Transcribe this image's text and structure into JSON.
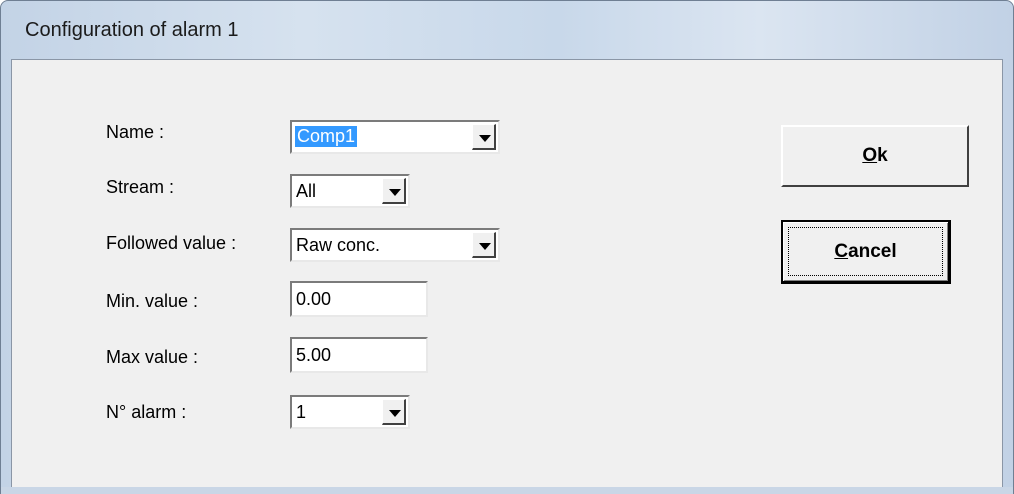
{
  "window": {
    "title": "Configuration of alarm 1"
  },
  "form": {
    "name": {
      "label": "Name :",
      "value": "Comp1"
    },
    "stream": {
      "label": "Stream :",
      "value": "All"
    },
    "followed": {
      "label": "Followed value :",
      "value": "Raw conc."
    },
    "min": {
      "label": "Min. value :",
      "value": "0.00"
    },
    "max": {
      "label": "Max value :",
      "value": "5.00"
    },
    "alarm_no": {
      "label": "N° alarm :",
      "value": "1"
    }
  },
  "buttons": {
    "ok": {
      "mnemonic": "O",
      "rest": "k"
    },
    "cancel": {
      "mnemonic": "C",
      "rest": "ancel"
    }
  },
  "icons": {
    "dropdown": "chevron-down-icon"
  }
}
